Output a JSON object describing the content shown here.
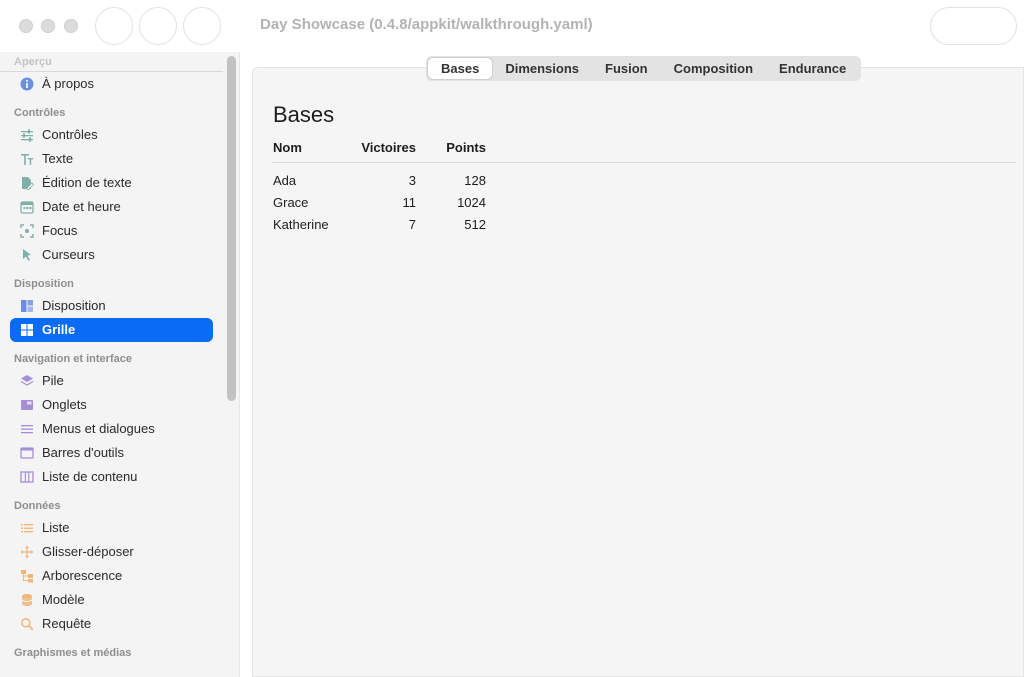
{
  "window": {
    "title": "Day Showcase (0.4.8/appkit/walkthrough.yaml)"
  },
  "sidebar": {
    "sections": [
      {
        "title": "Aperçu",
        "items": [
          {
            "label": "À propos",
            "icon": "info-icon",
            "color": "#6a8fe0"
          }
        ]
      },
      {
        "title": "Contrôles",
        "items": [
          {
            "label": "Contrôles",
            "icon": "sliders-icon",
            "color": "#7fb0a8"
          },
          {
            "label": "Texte",
            "icon": "text-icon",
            "color": "#7fb0a8"
          },
          {
            "label": "Édition de texte",
            "icon": "edit-document-icon",
            "color": "#7fb0a8"
          },
          {
            "label": "Date et heure",
            "icon": "calendar-icon",
            "color": "#7fb0a8"
          },
          {
            "label": "Focus",
            "icon": "focus-icon",
            "color": "#7fb0a8"
          },
          {
            "label": "Curseurs",
            "icon": "cursor-icon",
            "color": "#7fb0a8"
          }
        ]
      },
      {
        "title": "Disposition",
        "items": [
          {
            "label": "Disposition",
            "icon": "layout-icon",
            "color": "#6a8fe0"
          },
          {
            "label": "Grille",
            "icon": "grid-icon",
            "color": "#ffffff",
            "selected": true
          }
        ]
      },
      {
        "title": "Navigation et interface",
        "items": [
          {
            "label": "Pile",
            "icon": "stack-icon",
            "color": "#a48fd6"
          },
          {
            "label": "Onglets",
            "icon": "tabs-icon",
            "color": "#a48fd6"
          },
          {
            "label": "Menus et dialogues",
            "icon": "menu-icon",
            "color": "#a48fd6"
          },
          {
            "label": "Barres d'outils",
            "icon": "toolbar-icon",
            "color": "#a48fd6"
          },
          {
            "label": "Liste de contenu",
            "icon": "columns-icon",
            "color": "#a48fd6"
          }
        ]
      },
      {
        "title": "Données",
        "items": [
          {
            "label": "Liste",
            "icon": "list-icon",
            "color": "#eeb679"
          },
          {
            "label": "Glisser-déposer",
            "icon": "move-icon",
            "color": "#eeb679"
          },
          {
            "label": "Arborescence",
            "icon": "tree-icon",
            "color": "#eeb679"
          },
          {
            "label": "Modèle",
            "icon": "database-icon",
            "color": "#eeb679"
          },
          {
            "label": "Requête",
            "icon": "magnifier-icon",
            "color": "#eeb679"
          }
        ]
      },
      {
        "title": "Graphismes et médias",
        "items": []
      }
    ]
  },
  "tabs": [
    {
      "label": "Bases",
      "active": true
    },
    {
      "label": "Dimensions"
    },
    {
      "label": "Fusion"
    },
    {
      "label": "Composition"
    },
    {
      "label": "Endurance"
    }
  ],
  "main": {
    "title": "Bases",
    "columns": [
      "Nom",
      "Victoires",
      "Points"
    ],
    "rows": [
      {
        "name": "Ada",
        "wins": "3",
        "points": "128"
      },
      {
        "name": "Grace",
        "wins": "11",
        "points": "1024"
      },
      {
        "name": "Katherine",
        "wins": "7",
        "points": "512"
      }
    ]
  },
  "colors": {
    "accent": "#0a6cf5"
  }
}
